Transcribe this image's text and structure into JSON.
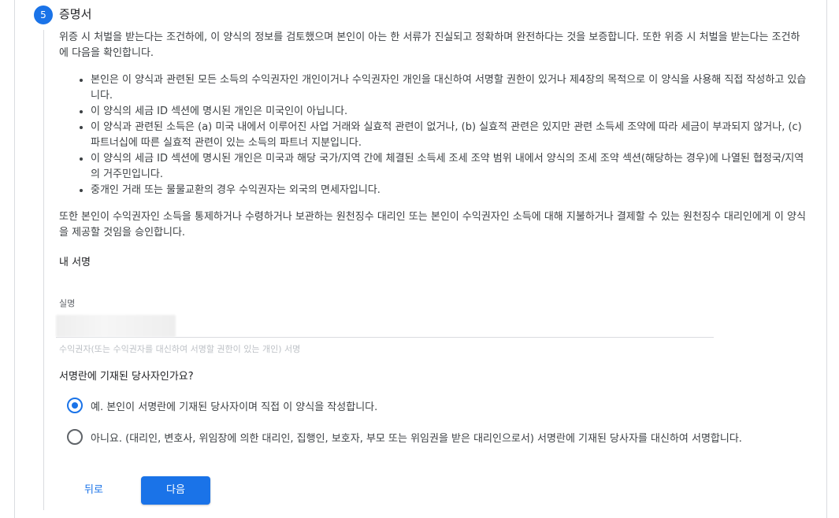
{
  "step": {
    "number": "5",
    "title": "증명서"
  },
  "intro": "위증 시 처벌을 받는다는 조건하에, 이 양식의 정보를 검토했으며 본인이 아는 한 서류가 진실되고 정확하며 완전하다는 것을 보증합니다. 또한 위증 시 처벌을 받는다는 조건하에 다음을 확인합니다.",
  "terms": [
    "본인은 이 양식과 관련된 모든 소득의 수익권자인 개인이거나 수익권자인 개인을 대신하여 서명할 권한이 있거나 제4장의 목적으로 이 양식을 사용해 직접 작성하고 있습니다.",
    "이 양식의 세금 ID 섹션에 명시된 개인은 미국인이 아닙니다.",
    "이 양식과 관련된 소득은 (a) 미국 내에서 이루어진 사업 거래와 실효적 관련이 없거나, (b) 실효적 관련은 있지만 관련 소득세 조약에 따라 세금이 부과되지 않거나, (c) 파트너십에 따른 실효적 관련이 있는 소득의 파트너 지분입니다.",
    "이 양식의 세금 ID 섹션에 명시된 개인은 미국과 해당 국가/지역 간에 체결된 소득세 조세 조약 범위 내에서 양식의 조세 조약 섹션(해당하는 경우)에 나열된 협정국/지역의 거주민입니다.",
    "중개인 거래 또는 물물교환의 경우 수익권자는 외국의 면세자입니다."
  ],
  "acknowledgement": "또한 본인이 수익권자인 소득을 통제하거나 수령하거나 보관하는 원천징수 대리인 또는 본인이 수익권자인 소득에 대해 지불하거나 결제할 수 있는 원천징수 대리인에게 이 양식을 제공할 것임을 승인합니다.",
  "signature": {
    "heading": "내 서명",
    "name_label": "실명",
    "name_value": "",
    "helper": "수익권자(또는 수익권자를 대신하여 서명할 권한이 있는 개인) 서명"
  },
  "question": "서명란에 기재된 당사자인가요?",
  "options": [
    {
      "label": "예. 본인이 서명란에 기재된 당사자이며 직접 이 양식을 작성합니다.",
      "selected": true
    },
    {
      "label": "아니요. (대리인, 변호사, 위임장에 의한 대리인, 집행인, 보호자, 부모 또는 위임권을 받은 대리인으로서) 서명란에 기재된 당사자를 대신하여 서명합니다.",
      "selected": false
    }
  ],
  "buttons": {
    "back": "뒤로",
    "next": "다음"
  },
  "colors": {
    "accent": "#1a73e8",
    "text": "#3c4043",
    "divider": "#dadce0"
  }
}
